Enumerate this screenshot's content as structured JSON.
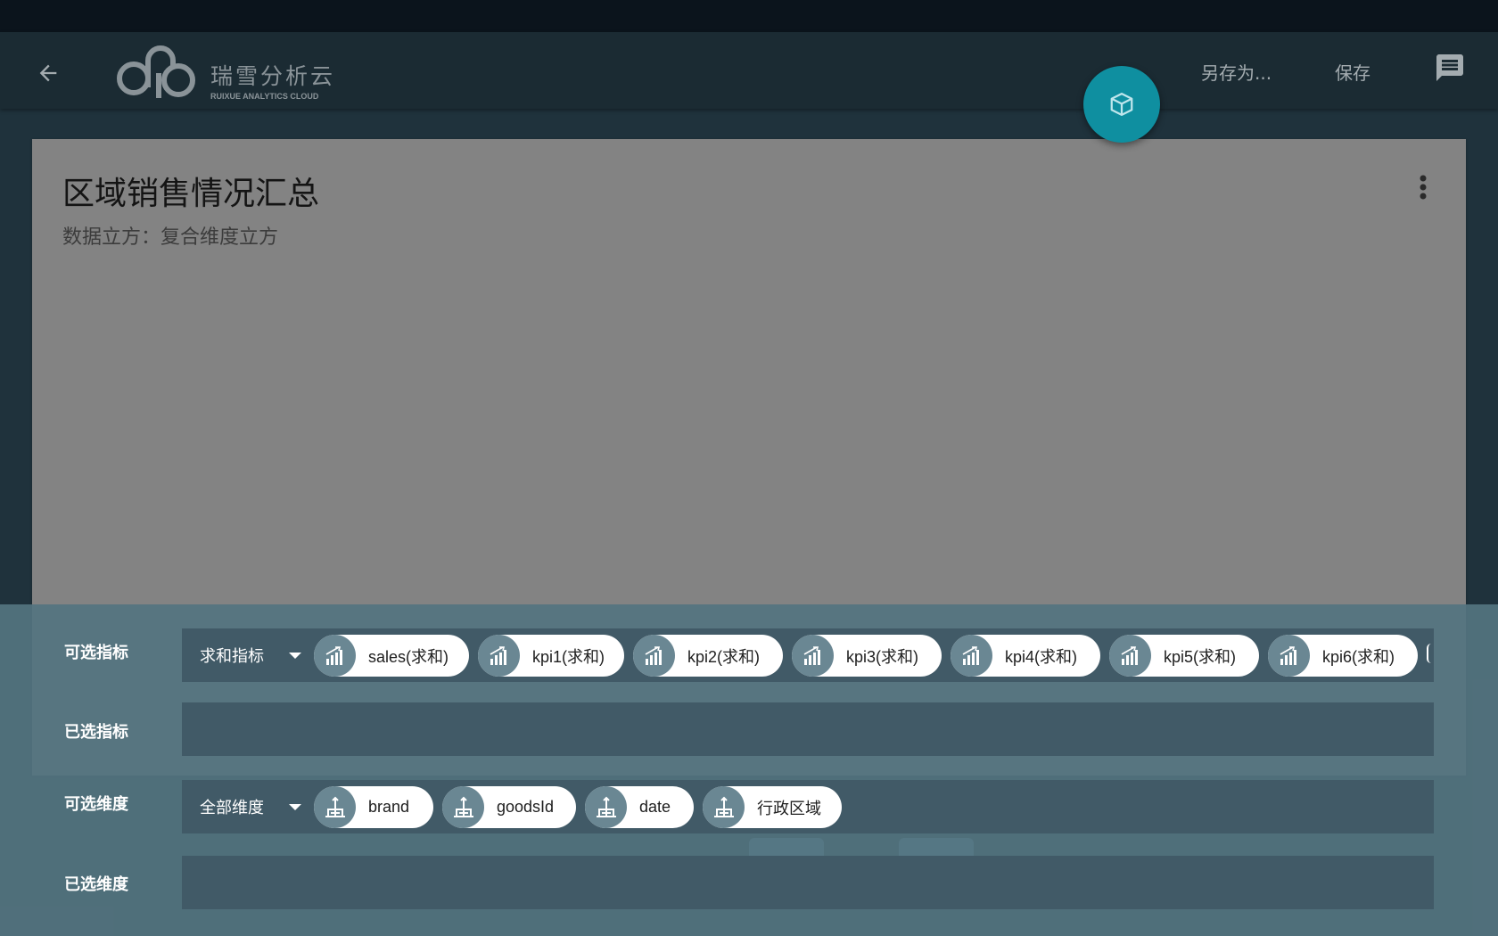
{
  "app": {
    "logo_cn": "瑞雪分析云",
    "logo_en": "RUIXUE ANALYTICS CLOUD",
    "save_as_label": "另存为...",
    "save_label": "保存",
    "back_icon": "arrow-left-icon",
    "chat_icon": "message-icon",
    "fab_icon": "cube-icon"
  },
  "card": {
    "title": "区域销售情况汇总",
    "subtitle": "数据立方：复合维度立方",
    "menu_icon": "more-vert-icon"
  },
  "panel": {
    "available_metrics_label": "可选指标",
    "selected_metrics_label": "已选指标",
    "available_dims_label": "可选维度",
    "selected_dims_label": "已选维度",
    "metric_filter": "求和指标",
    "dim_filter": "全部维度",
    "metrics": [
      {
        "label": "sales(求和)"
      },
      {
        "label": "kpi1(求和)"
      },
      {
        "label": "kpi2(求和)"
      },
      {
        "label": "kpi3(求和)"
      },
      {
        "label": "kpi4(求和)"
      },
      {
        "label": "kpi5(求和)"
      },
      {
        "label": "kpi6(求和)"
      }
    ],
    "dimensions": [
      {
        "label": "brand"
      },
      {
        "label": "goodsId"
      },
      {
        "label": "date"
      },
      {
        "label": "行政区域"
      }
    ]
  },
  "colors": {
    "fab": "#0f8fa0",
    "panel": "#547480",
    "row": "#415a67",
    "chip_icon": "#6a8793"
  }
}
